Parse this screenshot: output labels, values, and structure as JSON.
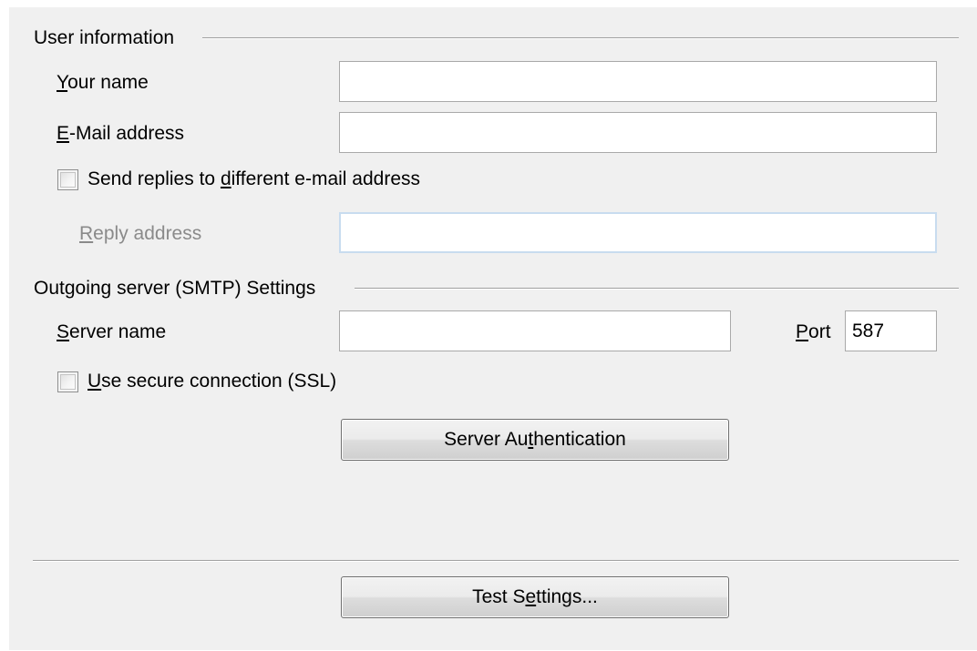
{
  "user_info": {
    "title": "User information",
    "your_name": {
      "pre": "",
      "key": "Y",
      "post": "our name",
      "value": ""
    },
    "email": {
      "pre": "",
      "key": "E",
      "post": "-Mail address",
      "value": ""
    },
    "send_replies": {
      "pre": "Send replies to ",
      "key": "d",
      "post": "ifferent e-mail address",
      "checked": false
    },
    "reply_address": {
      "pre": "",
      "key": "R",
      "post": "eply address",
      "value": ""
    }
  },
  "smtp": {
    "title": "Outgoing server (SMTP) Settings",
    "server_name": {
      "pre": "",
      "key": "S",
      "post": "erver name",
      "value": ""
    },
    "port": {
      "pre": "",
      "key": "P",
      "post": "ort",
      "value": "587"
    },
    "use_ssl": {
      "pre": "",
      "key": "U",
      "post": "se secure connection (SSL)",
      "checked": false
    },
    "server_auth_button": {
      "pre": "Server Au",
      "key": "t",
      "post": "hentication"
    }
  },
  "test_settings_button": {
    "pre": "Test S",
    "key": "e",
    "post": "ttings..."
  },
  "colors": {
    "panel_bg": "#f0f0f0",
    "disabled_text": "#8a8a8a",
    "disabled_border": "#c8dcef"
  }
}
